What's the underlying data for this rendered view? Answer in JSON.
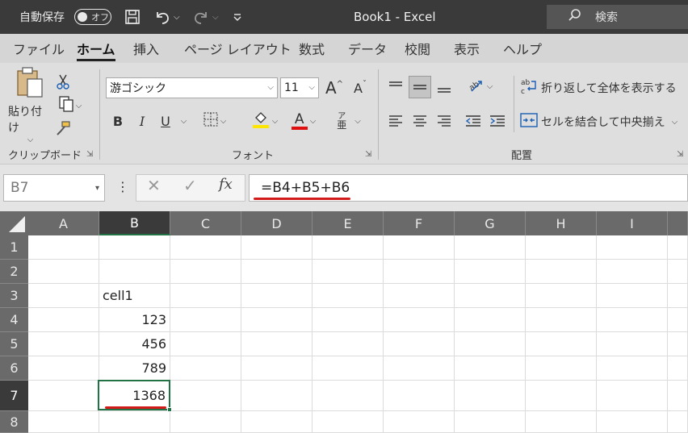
{
  "titlebar": {
    "autosave_label": "自動保存",
    "autosave_state": "オフ",
    "title": "Book1  -  Excel",
    "search_placeholder": "検索"
  },
  "tabs": [
    "ファイル",
    "ホーム",
    "挿入",
    "ページ レイアウト",
    "数式",
    "データ",
    "校閲",
    "表示",
    "ヘルプ"
  ],
  "active_tab": "ホーム",
  "ribbon": {
    "clipboard": {
      "paste_label": "貼り付け",
      "group_label": "クリップボード"
    },
    "font": {
      "font_name": "游ゴシック",
      "font_size": "11",
      "bold": "B",
      "italic": "I",
      "underline": "U",
      "font_color_glyph": "A",
      "phonetic_top": "ア",
      "phonetic_bottom": "亜",
      "grow_glyph": "A",
      "shrink_glyph": "A",
      "group_label": "フォント",
      "highlight_color": "#ffe600",
      "font_color": "#e01010"
    },
    "alignment": {
      "wrap_label": "折り返して全体を表示する",
      "merge_label": "セルを結合して中央揃え",
      "group_label": "配置"
    }
  },
  "formula_bar": {
    "name_box": "B7",
    "formula": "=B4+B5+B6",
    "cancel_glyph": "✕",
    "enter_glyph": "✓",
    "fx_glyph": "fx"
  },
  "sheet": {
    "columns": [
      "A",
      "B",
      "C",
      "D",
      "E",
      "F",
      "G",
      "H",
      "I"
    ],
    "rows": [
      "1",
      "2",
      "3",
      "4",
      "5",
      "6",
      "7",
      "8"
    ],
    "selected_column": "B",
    "selected_row": "7",
    "cells": {
      "B3": "cell1",
      "B4": "123",
      "B5": "456",
      "B6": "789",
      "B7": "1368"
    }
  },
  "colors": {
    "accent_green": "#217346",
    "annotation_red": "#d21a1a"
  }
}
